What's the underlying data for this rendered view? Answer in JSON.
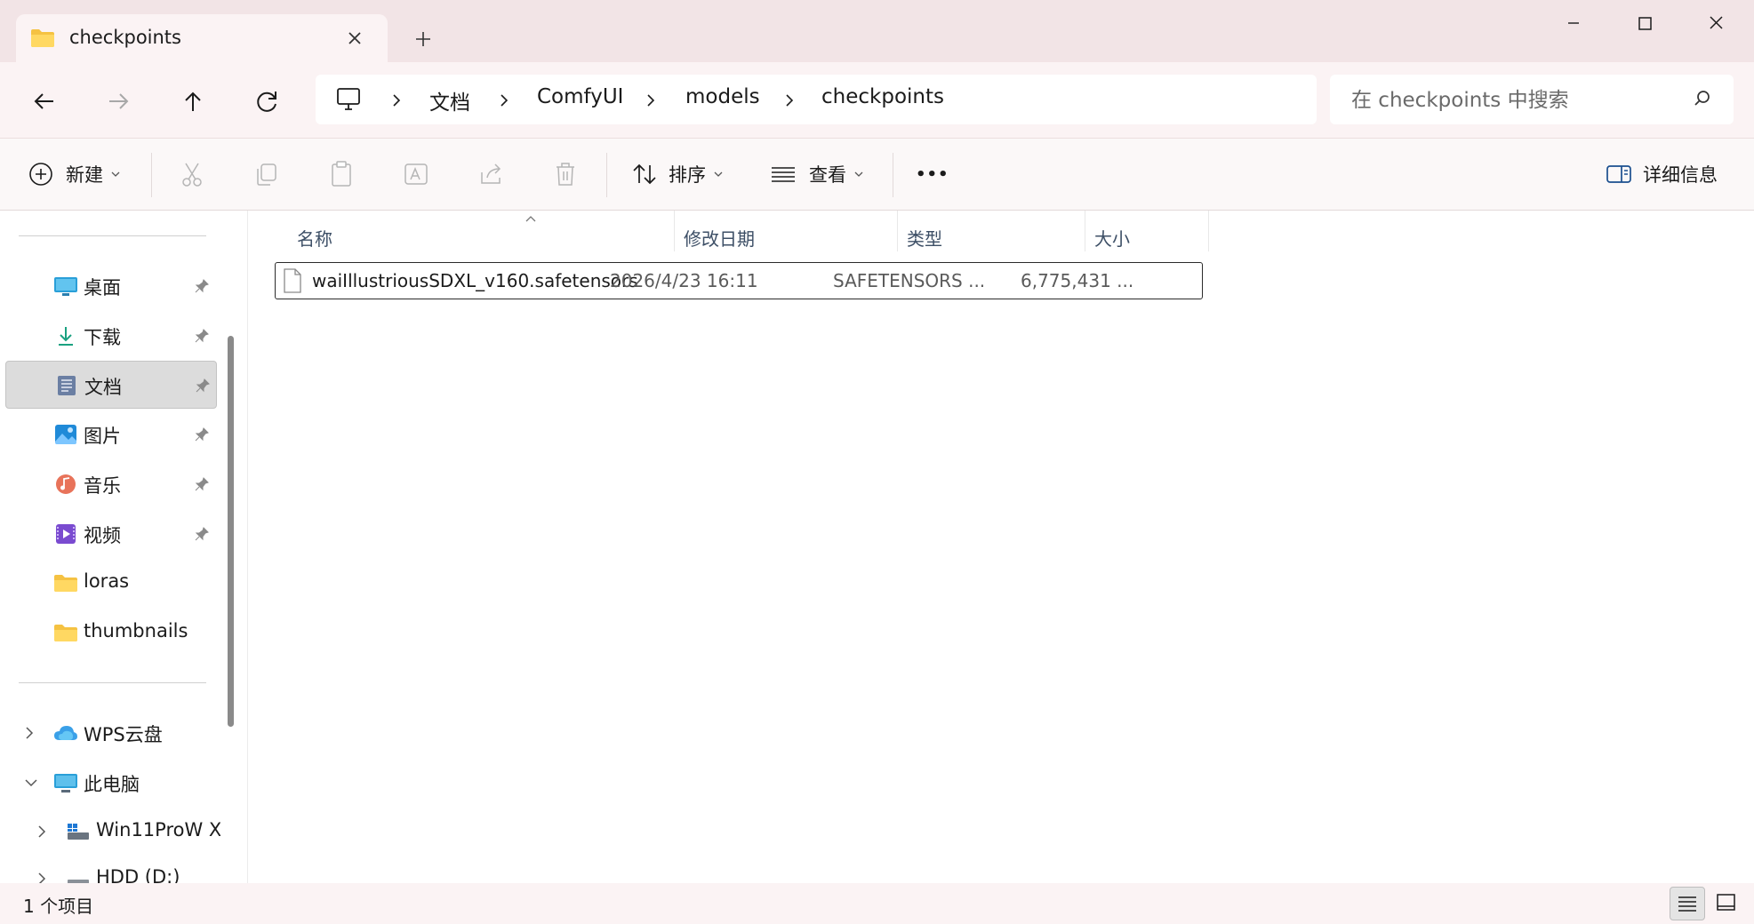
{
  "window": {
    "tab_title": "checkpoints",
    "new_tab_symbol": "+"
  },
  "navigation": {
    "breadcrumbs": [
      "文档",
      "ComfyUI",
      "models",
      "checkpoints"
    ],
    "search_placeholder": "在 checkpoints 中搜索"
  },
  "commands": {
    "new_label": "新建",
    "sort_label": "排序",
    "view_label": "查看",
    "more_symbol": "•••",
    "details_label": "详细信息"
  },
  "sidebar": {
    "quick_access": [
      {
        "label": "桌面",
        "icon": "desktop-icon",
        "pinned": true
      },
      {
        "label": "下载",
        "icon": "download-icon",
        "pinned": true
      },
      {
        "label": "文档",
        "icon": "documents-icon",
        "pinned": true,
        "selected": true
      },
      {
        "label": "图片",
        "icon": "pictures-icon",
        "pinned": true
      },
      {
        "label": "音乐",
        "icon": "music-icon",
        "pinned": true
      },
      {
        "label": "视频",
        "icon": "videos-icon",
        "pinned": true
      },
      {
        "label": "loras",
        "icon": "folder-icon",
        "pinned": false
      },
      {
        "label": "thumbnails",
        "icon": "folder-icon",
        "pinned": false
      }
    ],
    "tree": [
      {
        "label": "WPS云盘",
        "icon": "cloud-icon",
        "expanded": false
      },
      {
        "label": "此电脑",
        "icon": "computer-icon",
        "expanded": true
      },
      {
        "label": "Win11ProW X",
        "icon": "drive-icon",
        "expanded": false
      },
      {
        "label": "HDD (D:)",
        "icon": "drive-icon",
        "expanded": false
      }
    ]
  },
  "file_list": {
    "columns": [
      "名称",
      "修改日期",
      "类型",
      "大小"
    ],
    "rows": [
      {
        "name": "waiIllustriousSDXL_v160.safetensors",
        "modified": "2026/4/23 16:11",
        "type": "SAFETENSORS ...",
        "size": "6,775,431 ..."
      }
    ]
  },
  "status": {
    "item_count": "1 个项目"
  },
  "colors": {
    "title_bar": "#f2e4e6",
    "nav_bar": "#fbf3f4",
    "selected_item": "#dcdcdc",
    "column_header_text": "#3d4f66"
  }
}
